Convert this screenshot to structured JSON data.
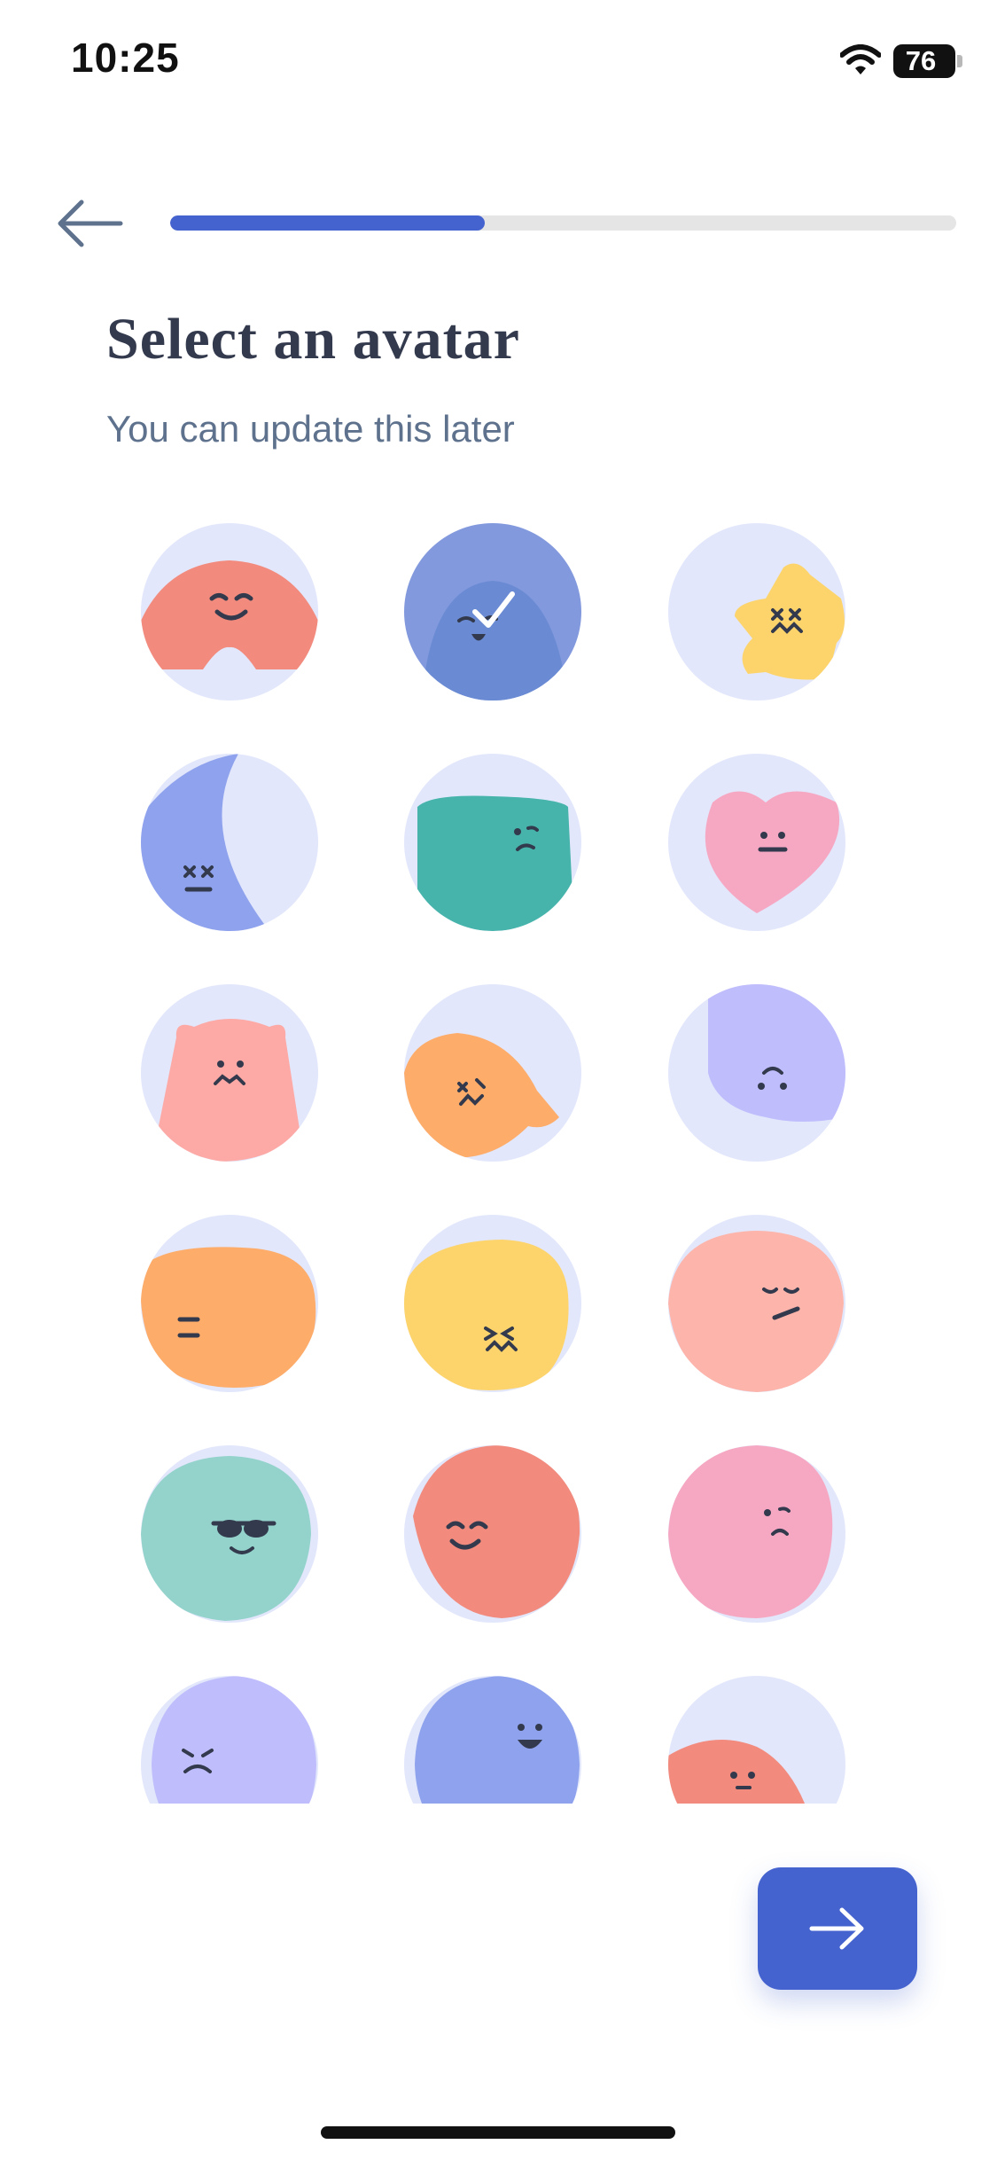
{
  "status_bar": {
    "time": "10:25",
    "battery_level": "76",
    "wifi_icon": "wifi-icon"
  },
  "header": {
    "back_icon": "arrow-left-icon",
    "progress_percent": 40
  },
  "page": {
    "title": "Select an avatar",
    "subtitle": "You can update this later"
  },
  "avatars": [
    {
      "name": "smiling-coral-blob",
      "color": "#f28b7d",
      "selected": false
    },
    {
      "name": "winking-blue-blob",
      "color": "#6a8bd3",
      "selected": true
    },
    {
      "name": "dizzy-yellow-star",
      "color": "#fdd46b",
      "selected": false
    },
    {
      "name": "sleepy-blue-moon",
      "color": "#8fa2ed",
      "selected": false
    },
    {
      "name": "skeptical-teal-blob",
      "color": "#47b4ab",
      "selected": false
    },
    {
      "name": "neutral-pink-heart",
      "color": "#f6a8c3",
      "selected": false
    },
    {
      "name": "pink-bear",
      "color": "#fdaaa6",
      "selected": false
    },
    {
      "name": "orange-fish",
      "color": "#fdac6a",
      "selected": false
    },
    {
      "name": "lavender-square",
      "color": "#c0bdfc",
      "selected": false
    },
    {
      "name": "neutral-orange-blob",
      "color": "#fdac6a",
      "selected": false
    },
    {
      "name": "squinting-yellow-blob",
      "color": "#fdd46b",
      "selected": false
    },
    {
      "name": "smirking-peach-blob",
      "color": "#fdb4aa",
      "selected": false
    },
    {
      "name": "cool-mint-blob",
      "color": "#94d3cb",
      "selected": false
    },
    {
      "name": "happy-coral-blob",
      "color": "#f28b7d",
      "selected": false
    },
    {
      "name": "confused-pink-blob",
      "color": "#f6a8c3",
      "selected": false
    },
    {
      "name": "grumpy-lavender-blob",
      "color": "#c0bdfc",
      "selected": false
    },
    {
      "name": "cheerful-blue-blob",
      "color": "#8fa2ed",
      "selected": false
    },
    {
      "name": "peeking-coral-blob",
      "color": "#f28b7d",
      "selected": false
    }
  ],
  "footer": {
    "next_icon": "arrow-right-icon"
  }
}
